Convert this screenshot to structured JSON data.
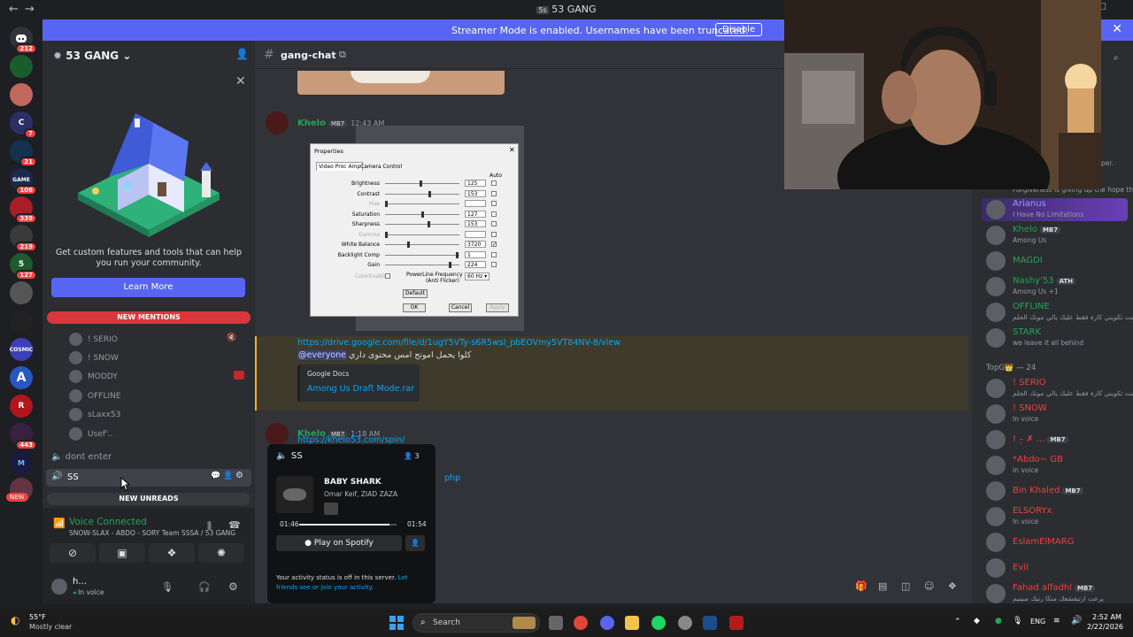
{
  "app": {
    "window_title": "53 GANG",
    "server_icon_label": "5s"
  },
  "banner": {
    "text": "Streamer Mode is enabled. Usernames have been truncated.",
    "button": "Disable"
  },
  "rail": {
    "badges": [
      "212",
      "7",
      "21",
      "106",
      "339",
      "219",
      "127",
      "443",
      "NEW"
    ]
  },
  "sidebar": {
    "server_name": "53 GANG",
    "promo_text": "Get custom features and tools that can help you run your community.",
    "learn_more": "Learn More",
    "new_mentions": "NEW MENTIONS",
    "voice_users": [
      "! SERIO",
      "! SNOW",
      "MODDY",
      "OFFLINE",
      "sLaxx53",
      "Usef'‥"
    ],
    "channel_dont_enter": "dont enter",
    "channel_ss": "SS",
    "new_unreads": "NEW UNREADS"
  },
  "voice": {
    "status": "Voice Connected",
    "location": "SNOW-SLAX - ABDO - SORY Team SSSA / 53 GANG",
    "user_name": "h...",
    "user_status": "In voice"
  },
  "chat": {
    "channel_name": "gang-chat",
    "msg1_author": "Khelo",
    "msg1_tag": "MB7",
    "msg1_time": "12:43 AM",
    "link": "https://drive.google.com/file/d/1ugY5VTy-s6R5wsI_pbEOVmy5VT84NV-8/view",
    "mention": "@everyone",
    "arabic_text": "كلوا يحمل اموتج امس محتوى داري",
    "embed_provider": "Google Docs",
    "embed_title": "Among Us Draft Mode.rar",
    "msg2_author": "Khelo",
    "msg2_tag": "MB7",
    "msg2_time": "1:18 AM",
    "msg2_link": "https://khelo53.com/spin/",
    "msg2_fragment": "php"
  },
  "properties": {
    "title": "Properties",
    "tab1": "Video Proc Amp",
    "tab2": "Camera Control",
    "auto": "Auto",
    "rows": [
      {
        "label": "Brightness",
        "value": "125",
        "knob": 0.48
      },
      {
        "label": "Contrast",
        "value": "153",
        "knob": 0.6
      },
      {
        "label": "Hue",
        "value": "",
        "knob": 0.0
      },
      {
        "label": "Saturation",
        "value": "127",
        "knob": 0.5
      },
      {
        "label": "Sharpness",
        "value": "153",
        "knob": 0.58
      },
      {
        "label": "Gamma",
        "value": "",
        "knob": 0.0
      },
      {
        "label": "White Balance",
        "value": "3720",
        "knob": 0.3
      },
      {
        "label": "Backlight Comp",
        "value": "1",
        "knob": 0.98
      },
      {
        "label": "Gain",
        "value": "224",
        "knob": 0.88
      }
    ],
    "color_enable": "ColorEnable",
    "powerline": "PowerLine Frequency\n(Anti Flicker)",
    "powerline_value": "60 Hz",
    "default_btn": "Default",
    "ok": "OK",
    "cancel": "Cancel",
    "apply": "Apply"
  },
  "popup": {
    "channel": "SS",
    "count": "3",
    "song": "BABY SHARK",
    "artists": "Omar Keif, ZIAD ZAZA",
    "elapsed": "01:46",
    "total": "01:54",
    "progress": 0.93,
    "play_button": "Play on Spotify",
    "activity_note": "Your activity status is off in this server.",
    "activity_link": "Let friends see or join your activity."
  },
  "members": {
    "truncated_top": "per.",
    "truncated_line": "Forgiveness is giving up the hope tha",
    "list_a": [
      {
        "name": "Arianus",
        "sub": "I Have No Limitations",
        "tag": "",
        "color": "#949cf7"
      },
      {
        "name": "Khelo",
        "sub": "Among Us",
        "tag": "MB7",
        "color": "#23a55a"
      },
      {
        "name": "MAGDI",
        "sub": "",
        "tag": "",
        "color": "#23a55a"
      },
      {
        "name": "Nashy'53",
        "sub": "Among Us +1",
        "tag": "ATH",
        "color": "#23a55a"
      },
      {
        "name": "OFFLINE",
        "sub": "كنت تكويني كارة فقط عليك يالي مونك الحلم",
        "tag": "",
        "color": "#23a55a"
      },
      {
        "name": "STARK",
        "sub": "we leave it all behind",
        "tag": "",
        "color": "#23a55a"
      }
    ],
    "group_label": "TopG👑 — 24",
    "list_b": [
      {
        "name": "! SERIO",
        "sub": "كنت تكويني كارة فقط عليك يالي مونك الحلم",
        "tag": "",
        "color": "#f23f42"
      },
      {
        "name": "! SNOW",
        "sub": "In voice",
        "tag": "",
        "color": "#f23f42"
      },
      {
        "name": "! ~۪ ✗ ...",
        "sub": "",
        "tag": "MB7",
        "color": "#f23f42"
      },
      {
        "name": "*Abdo~ GB",
        "sub": "In voice",
        "tag": "",
        "color": "#f23f42"
      },
      {
        "name": "Bin Khaled",
        "sub": "",
        "tag": "MB7",
        "color": "#f23f42"
      },
      {
        "name": "ELSORYx",
        "sub": "In voice",
        "tag": "",
        "color": "#f23f42"
      },
      {
        "name": "EslamElMARG",
        "sub": "",
        "tag": "",
        "color": "#f23f42"
      },
      {
        "name": "Evil",
        "sub": "",
        "tag": "",
        "color": "#f23f42"
      },
      {
        "name": "Fahad alfadhl",
        "sub": "يرعت ارتيفشعك منكا رتيك منينيم",
        "tag": "MB7",
        "color": "#f23f42"
      }
    ]
  },
  "taskbar": {
    "temp": "55°F",
    "weather": "Mostly clear",
    "search": "Search",
    "lang": "ENG",
    "time": "2:52 AM",
    "date": "2/22/2026"
  },
  "colors": {
    "blurple": "#5865f2",
    "green": "#23a55a",
    "red": "#f23f42",
    "link": "#00a8fc"
  }
}
